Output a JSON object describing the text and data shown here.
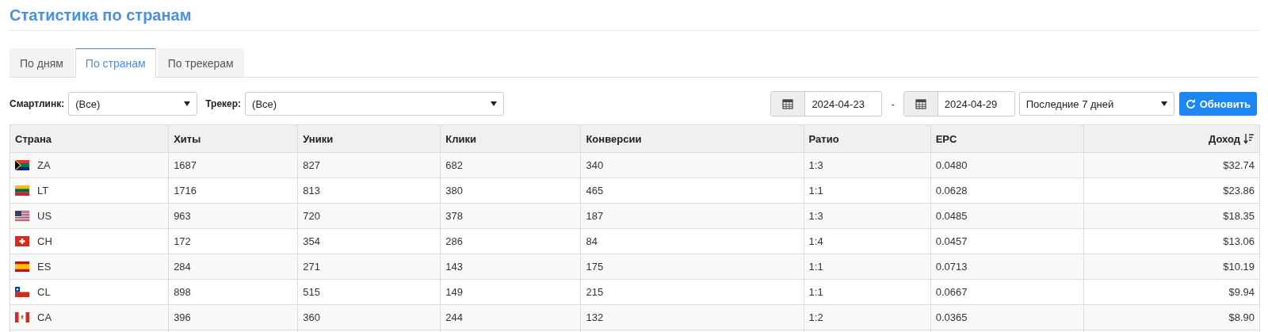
{
  "title": "Статистика по странам",
  "tabs": [
    {
      "label": "По дням",
      "selected": false
    },
    {
      "label": "По странам",
      "selected": true
    },
    {
      "label": "По трекерам",
      "selected": false
    }
  ],
  "filters": {
    "smartlink": {
      "label": "Смартлинк:",
      "value": "(Все)"
    },
    "tracker": {
      "label": "Трекер:",
      "value": "(Все)"
    },
    "date_from": "2024-04-23",
    "date_separator": "-",
    "date_to": "2024-04-29",
    "period": "Последние 7 дней",
    "refresh_button": "Обновить"
  },
  "table": {
    "columns": [
      {
        "label": "Страна",
        "sorted": false
      },
      {
        "label": "Хиты",
        "sorted": false
      },
      {
        "label": "Уники",
        "sorted": false
      },
      {
        "label": "Клики",
        "sorted": false
      },
      {
        "label": "Конверсии",
        "sorted": false
      },
      {
        "label": "Ратио",
        "sorted": false
      },
      {
        "label": "EPC",
        "sorted": false
      },
      {
        "label": "Доход",
        "sorted": true
      }
    ],
    "rows": [
      [
        "ZA",
        "1687",
        "827",
        "682",
        "340",
        "1:3",
        "0.0480",
        "$32.74"
      ],
      [
        "LT",
        "1716",
        "813",
        "380",
        "465",
        "1:1",
        "0.0628",
        "$23.86"
      ],
      [
        "US",
        "963",
        "720",
        "378",
        "187",
        "1:3",
        "0.0485",
        "$18.35"
      ],
      [
        "CH",
        "172",
        "354",
        "286",
        "84",
        "1:4",
        "0.0457",
        "$13.06"
      ],
      [
        "ES",
        "284",
        "271",
        "143",
        "175",
        "1:1",
        "0.0713",
        "$10.19"
      ],
      [
        "CL",
        "898",
        "515",
        "149",
        "215",
        "1:1",
        "0.0667",
        "$9.94"
      ],
      [
        "CA",
        "396",
        "360",
        "244",
        "132",
        "1:2",
        "0.0365",
        "$8.90"
      ]
    ]
  }
}
